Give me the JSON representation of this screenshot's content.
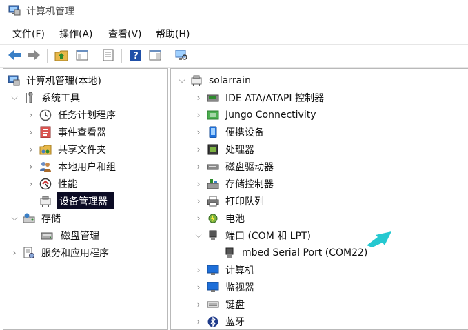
{
  "window": {
    "title": "计算机管理"
  },
  "menu": [
    {
      "label": "文件(F)"
    },
    {
      "label": "操作(A)"
    },
    {
      "label": "查看(V)"
    },
    {
      "label": "帮助(H)"
    }
  ],
  "left_tree": {
    "root": "计算机管理(本地)",
    "system_tools": "系统工具",
    "task_scheduler": "任务计划程序",
    "event_viewer": "事件查看器",
    "shared_folders": "共享文件夹",
    "local_users": "本地用户和组",
    "performance": "性能",
    "device_manager": "设备管理器",
    "storage": "存储",
    "disk_management": "磁盘管理",
    "services_apps": "服务和应用程序"
  },
  "right_tree": {
    "computer": "solarrain",
    "ide": "IDE ATA/ATAPI 控制器",
    "jungo": "Jungo Connectivity",
    "portable": "便携设备",
    "processor": "处理器",
    "disk_drives": "磁盘驱动器",
    "storage_ctrl": "存储控制器",
    "print_queue": "打印队列",
    "battery": "电池",
    "ports": "端口 (COM 和 LPT)",
    "mbed_port": "mbed Serial Port (COM22)",
    "computer_cat": "计算机",
    "monitor": "监视器",
    "keyboard": "键盘",
    "bluetooth": "蓝牙"
  },
  "colors": {
    "selection": "#0b0b24",
    "annotation_arrow": "#25c8d0"
  }
}
